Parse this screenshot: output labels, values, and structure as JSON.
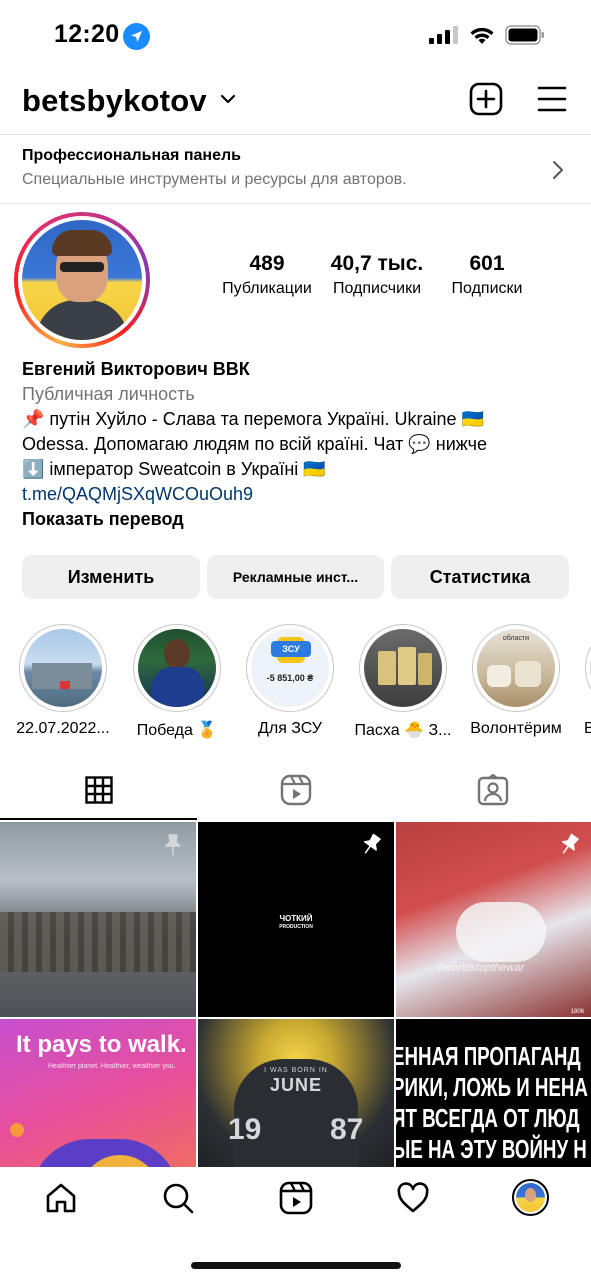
{
  "status_bar": {
    "time": "12:20"
  },
  "header": {
    "username": "betsbykotov"
  },
  "pro_panel": {
    "title": "Профессиональная панель",
    "subtitle": "Специальные инструменты и ресурсы для авторов."
  },
  "stats": {
    "posts": {
      "value": "489",
      "label": "Публикации"
    },
    "followers": {
      "value": "40,7 тыс.",
      "label": "Подписчики"
    },
    "following": {
      "value": "601",
      "label": "Подписки"
    }
  },
  "bio": {
    "name": "Евгений Викторович ВВК",
    "category": "Публичная личность",
    "line1": "📌 путін Хуйло - Слава та перемога Україні. Ukraine 🇺🇦",
    "line2": "Odessa. Допомагаю людям по всій країні. Чат 💬 нижче",
    "line3": "⬇️ імператор Sweatcoin в Україні 🇺🇦",
    "link": "t.me/QAQMjSXqWCOuOuh9",
    "translate": "Показать перевод"
  },
  "buttons": {
    "edit": "Изменить",
    "ads": "Рекламные инст...",
    "stats": "Статистика"
  },
  "highlights": [
    {
      "label": "22.07.2022..."
    },
    {
      "label": "Победа 🏅"
    },
    {
      "label": "Для ЗСУ",
      "badge": "ЗСУ",
      "amount": "-5 851,00 ₴"
    },
    {
      "label": "Пасха 🐣 З..."
    },
    {
      "label": "Волонтёрим",
      "overlay": "области"
    },
    {
      "label": "В"
    }
  ],
  "tabs": [
    "grid-icon",
    "reels-icon",
    "tagged-icon"
  ],
  "grid": {
    "post2_text_line1": "ЧОТКИЙ",
    "post2_text_line2": "PRODUCTION",
    "post3_watermark": "#worldstopthewar",
    "post3_count": "1806",
    "post4_title": "It pays to walk.",
    "post4_sub": "Healthier planet. Healthier, wealthier you.",
    "post5_line1": "I WAS BORN IN",
    "post5_line2": "JUNE",
    "post5_num_left": "19",
    "post5_num_right": "87",
    "post6_lines": [
      "ЕННАЯ ПРОПАГАНД",
      "РИКИ, ЛОЖЬ И НЕНА",
      "ЯТ ВСЕГДА ОТ ЛЮД",
      "ЫЕ НА ЭТУ ВОЙНУ Н"
    ]
  },
  "colors": {
    "link": "#00376b",
    "muted": "#737373",
    "button_bg": "#efefef"
  }
}
